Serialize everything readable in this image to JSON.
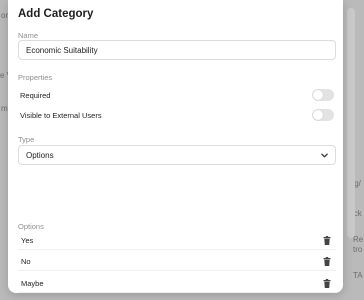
{
  "background": {
    "fragments": [
      "or",
      "e V",
      "m",
      "tg/",
      "ick",
      "Re",
      "tro",
      "TA"
    ]
  },
  "modal": {
    "title": "Add Category",
    "name_label": "Name",
    "name_value": "Economic Suitability",
    "properties_label": "Properties",
    "properties": [
      {
        "label": "Required",
        "enabled": false
      },
      {
        "label": "Visible to External Users",
        "enabled": false
      }
    ],
    "type_label": "Type",
    "type_value": "Options",
    "options_label": "Options",
    "options": [
      {
        "label": "Yes"
      },
      {
        "label": "No"
      },
      {
        "label": "Maybe"
      }
    ]
  },
  "icons": {
    "dropdown": "chevron-down-icon",
    "delete": "trash-icon"
  },
  "colors": {
    "toggle_off": "#e3e3e3",
    "scrollbar": "#c9c9c9"
  }
}
